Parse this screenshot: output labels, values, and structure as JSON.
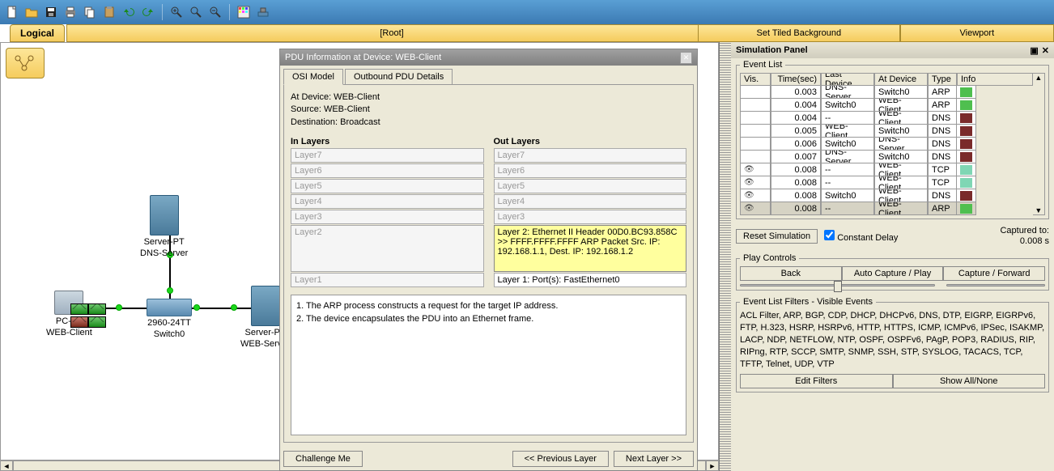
{
  "logical_header": {
    "tab": "Logical",
    "root": "[Root]",
    "bg_btn": "Set Tiled Background",
    "viewport_btn": "Viewport"
  },
  "dialog": {
    "title": "PDU Information at Device: WEB-Client",
    "tab_osi": "OSI Model",
    "tab_outbound": "Outbound PDU Details",
    "at_device": "At Device: WEB-Client",
    "source": "Source: WEB-Client",
    "destination": "Destination: Broadcast",
    "in_layers_h": "In Layers",
    "out_layers_h": "Out Layers",
    "layers": {
      "l7": "Layer7",
      "l6": "Layer6",
      "l5": "Layer5",
      "l4": "Layer4",
      "l3": "Layer3",
      "l2": "Layer2",
      "l1": "Layer1"
    },
    "out_l2": "Layer 2: Ethernet II Header 00D0.BC93.858C >> FFFF.FFFF.FFFF ARP Packet Src. IP: 192.168.1.1, Dest. IP: 192.168.1.2",
    "out_l1": "Layer 1: Port(s): FastEthernet0",
    "note1": "1. The ARP process constructs a request for the target IP address.",
    "note2": "2. The device encapsulates the PDU into an Ethernet frame.",
    "btn_challenge": "Challenge Me",
    "btn_prev": "<< Previous Layer",
    "btn_next": "Next Layer >>"
  },
  "sim": {
    "title": "Simulation Panel",
    "event_list_legend": "Event List",
    "cols": {
      "vis": "Vis.",
      "time": "Time(sec)",
      "ldev": "Last Device",
      "adev": "At Device",
      "type": "Type",
      "info": "Info"
    },
    "rows": [
      {
        "eye": false,
        "t": "0.003",
        "ld": "DNS-Server",
        "ad": "Switch0",
        "ty": "ARP",
        "c": "#4fbf4f"
      },
      {
        "eye": false,
        "t": "0.004",
        "ld": "Switch0",
        "ad": "WEB-Client",
        "ty": "ARP",
        "c": "#4fbf4f"
      },
      {
        "eye": false,
        "t": "0.004",
        "ld": "--",
        "ad": "WEB-Client",
        "ty": "DNS",
        "c": "#7a2a2a"
      },
      {
        "eye": false,
        "t": "0.005",
        "ld": "WEB-Client",
        "ad": "Switch0",
        "ty": "DNS",
        "c": "#7a2a2a"
      },
      {
        "eye": false,
        "t": "0.006",
        "ld": "Switch0",
        "ad": "DNS-Server",
        "ty": "DNS",
        "c": "#7a2a2a"
      },
      {
        "eye": false,
        "t": "0.007",
        "ld": "DNS-Server",
        "ad": "Switch0",
        "ty": "DNS",
        "c": "#7a2a2a"
      },
      {
        "eye": true,
        "t": "0.008",
        "ld": "--",
        "ad": "WEB-Client",
        "ty": "TCP",
        "c": "#7fd6b4"
      },
      {
        "eye": true,
        "t": "0.008",
        "ld": "--",
        "ad": "WEB-Client",
        "ty": "TCP",
        "c": "#7fd6b4"
      },
      {
        "eye": true,
        "t": "0.008",
        "ld": "Switch0",
        "ad": "WEB-Client",
        "ty": "DNS",
        "c": "#7a2a2a"
      },
      {
        "eye": true,
        "t": "0.008",
        "ld": "--",
        "ad": "WEB-Client",
        "ty": "ARP",
        "c": "#4fbf4f",
        "sel": true
      }
    ],
    "reset_btn": "Reset Simulation",
    "constant_delay": "Constant Delay",
    "captured_lbl": "Captured to:",
    "captured_val": "0.008 s",
    "play_legend": "Play Controls",
    "btn_back": "Back",
    "btn_auto": "Auto Capture / Play",
    "btn_fwd": "Capture / Forward",
    "filters_legend": "Event List Filters - Visible Events",
    "filters_text": "ACL Filter, ARP, BGP, CDP, DHCP, DHCPv6, DNS, DTP, EIGRP, EIGRPv6, FTP, H.323, HSRP, HSRPv6, HTTP, HTTPS, ICMP, ICMPv6, IPSec, ISAKMP, LACP, NDP, NETFLOW, NTP, OSPF, OSPFv6, PAgP, POP3, RADIUS, RIP, RIPng, RTP, SCCP, SMTP, SNMP, SSH, STP, SYSLOG, TACACS, TCP, TFTP, Telnet, UDP, VTP",
    "btn_edit_filters": "Edit Filters",
    "btn_show_all": "Show All/None"
  },
  "devices": {
    "dns": {
      "l1": "Server-PT",
      "l2": "DNS-Server"
    },
    "sw": {
      "l1": "2960-24TT",
      "l2": "Switch0"
    },
    "pc": {
      "l1": "PC-PT",
      "l2": "WEB-Client"
    },
    "web": {
      "l1": "Server-PT",
      "l2": "WEB-Server"
    }
  }
}
